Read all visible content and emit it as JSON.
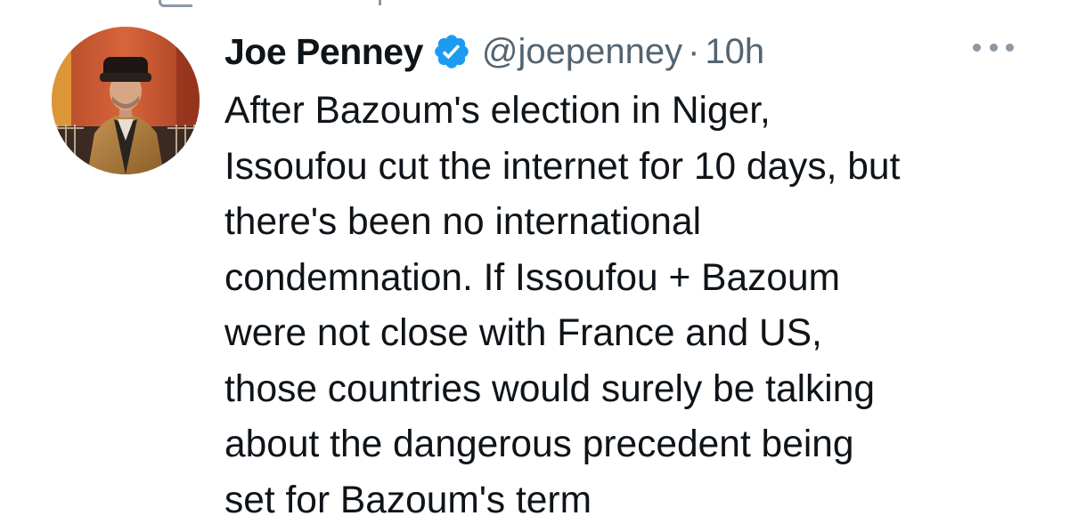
{
  "tweet": {
    "author": {
      "display_name": "Joe Penney",
      "handle": "@joepenney",
      "verified": true,
      "avatar_icon": "profile-photo"
    },
    "separator": "·",
    "timestamp": "10h",
    "more_icon": "ellipsis-icon",
    "text_lines": [
      "After Bazoum's election in Niger,",
      "Issoufou cut the internet for 10 days, but",
      "there's been no international",
      "condemnation. If Issoufou + Bazoum",
      "were not close with France and US,",
      "those countries would surely be talking",
      "about the dangerous precedent being",
      "set for Bazoum's term"
    ]
  },
  "colors": {
    "text_primary": "#0f1419",
    "text_secondary": "#536471",
    "verified_blue": "#1d9bf0",
    "icon_gray": "#8b98a5"
  }
}
